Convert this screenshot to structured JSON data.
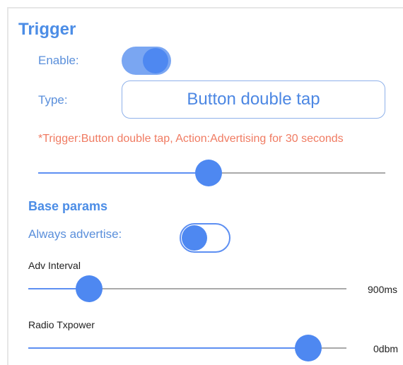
{
  "trigger": {
    "title": "Trigger",
    "enable_label": "Enable:",
    "enable_on": true,
    "type_label": "Type:",
    "type_value": "Button double tap",
    "note": "*Trigger:Button double tap, Action:Advertising for 30 seconds",
    "slider_fraction": 0.49
  },
  "base": {
    "title": "Base params",
    "always_advertise_label": "Always advertise:",
    "always_advertise_on": false,
    "adv_interval_label": "Adv Interval",
    "adv_interval_value": "900ms",
    "adv_interval_fraction": 0.19,
    "radio_txpower_label": "Radio Txpower",
    "radio_txpower_value": "0dbm",
    "radio_txpower_fraction": 0.88
  },
  "colors": {
    "accent": "#4e88f1",
    "note": "#f07b62",
    "title": "#4c8de6"
  }
}
